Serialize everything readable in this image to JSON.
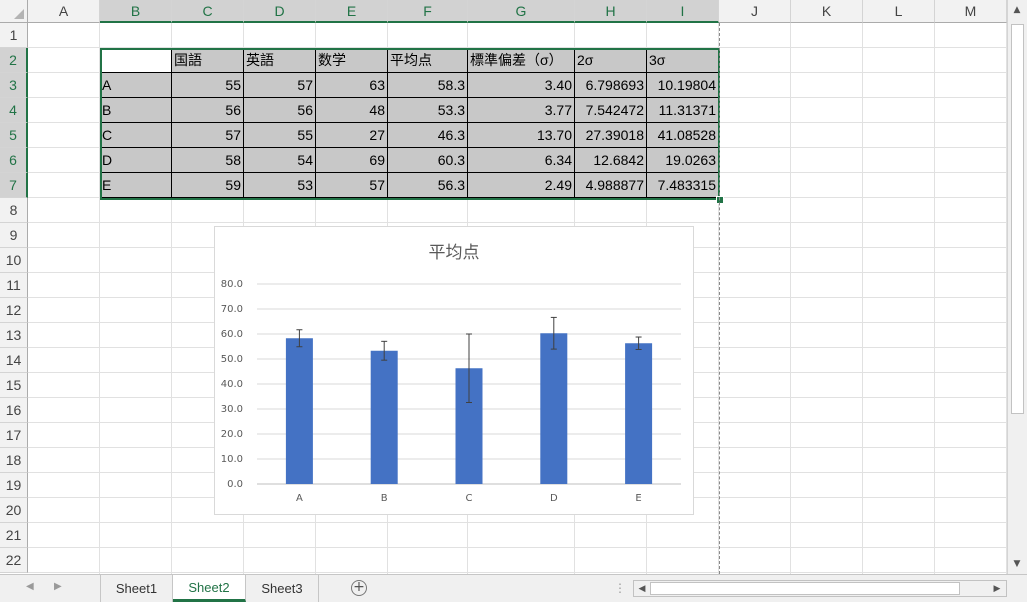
{
  "columns": [
    "A",
    "B",
    "C",
    "D",
    "E",
    "F",
    "G",
    "H",
    "I",
    "J",
    "K",
    "L",
    "M"
  ],
  "selected_columns": [
    "B",
    "C",
    "D",
    "E",
    "F",
    "G",
    "H",
    "I"
  ],
  "rows": [
    "1",
    "2",
    "3",
    "4",
    "5",
    "6",
    "7",
    "8",
    "9",
    "10",
    "11",
    "12",
    "13",
    "14",
    "15",
    "16",
    "17",
    "18",
    "19",
    "20",
    "21",
    "22"
  ],
  "selected_rows": [
    "2",
    "3",
    "4",
    "5",
    "6",
    "7"
  ],
  "table": {
    "headers": [
      "",
      "国語",
      "英語",
      "数学",
      "平均点",
      "標準偏差（σ）",
      "2σ",
      "3σ"
    ],
    "rows": [
      [
        "A",
        "55",
        "57",
        "63",
        "58.3",
        "3.40",
        "6.798693",
        "10.19804"
      ],
      [
        "B",
        "56",
        "56",
        "48",
        "53.3",
        "3.77",
        "7.542472",
        "11.31371"
      ],
      [
        "C",
        "57",
        "55",
        "27",
        "46.3",
        "13.70",
        "27.39018",
        "41.08528"
      ],
      [
        "D",
        "58",
        "54",
        "69",
        "60.3",
        "6.34",
        "12.6842",
        "19.0263"
      ],
      [
        "E",
        "59",
        "53",
        "57",
        "56.3",
        "2.49",
        "4.988877",
        "7.483315"
      ]
    ]
  },
  "chart_data": {
    "type": "bar",
    "title": "平均点",
    "categories": [
      "A",
      "B",
      "C",
      "D",
      "E"
    ],
    "values": [
      58.3,
      53.3,
      46.3,
      60.3,
      56.3
    ],
    "error": [
      3.4,
      3.77,
      13.7,
      6.34,
      2.49
    ],
    "ylim": [
      0,
      80
    ],
    "yticks": [
      "0.0",
      "10.0",
      "20.0",
      "30.0",
      "40.0",
      "50.0",
      "60.0",
      "70.0",
      "80.0"
    ],
    "grid": true,
    "bar_color": "#4472c4"
  },
  "tabs": [
    "Sheet1",
    "Sheet2",
    "Sheet3"
  ],
  "active_tab": "Sheet2",
  "add_sheet_label": "+",
  "colors": {
    "accent": "#217346"
  }
}
